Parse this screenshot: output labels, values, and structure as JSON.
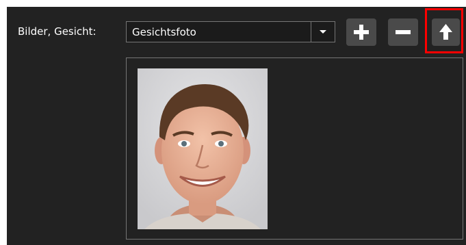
{
  "form": {
    "label": "Bilder, Gesicht:",
    "select_value": "Gesichtsfoto"
  },
  "icons": {
    "dropdown": "chevron-down-icon",
    "add": "plus-icon",
    "remove": "minus-icon",
    "upload": "arrow-up-icon"
  },
  "image": {
    "subject": "face photo of smiling young man"
  },
  "colors": {
    "background": "#222222",
    "button": "#4a4a4a",
    "border": "#767676",
    "highlight": "#ff0000",
    "text": "#ffffff"
  }
}
